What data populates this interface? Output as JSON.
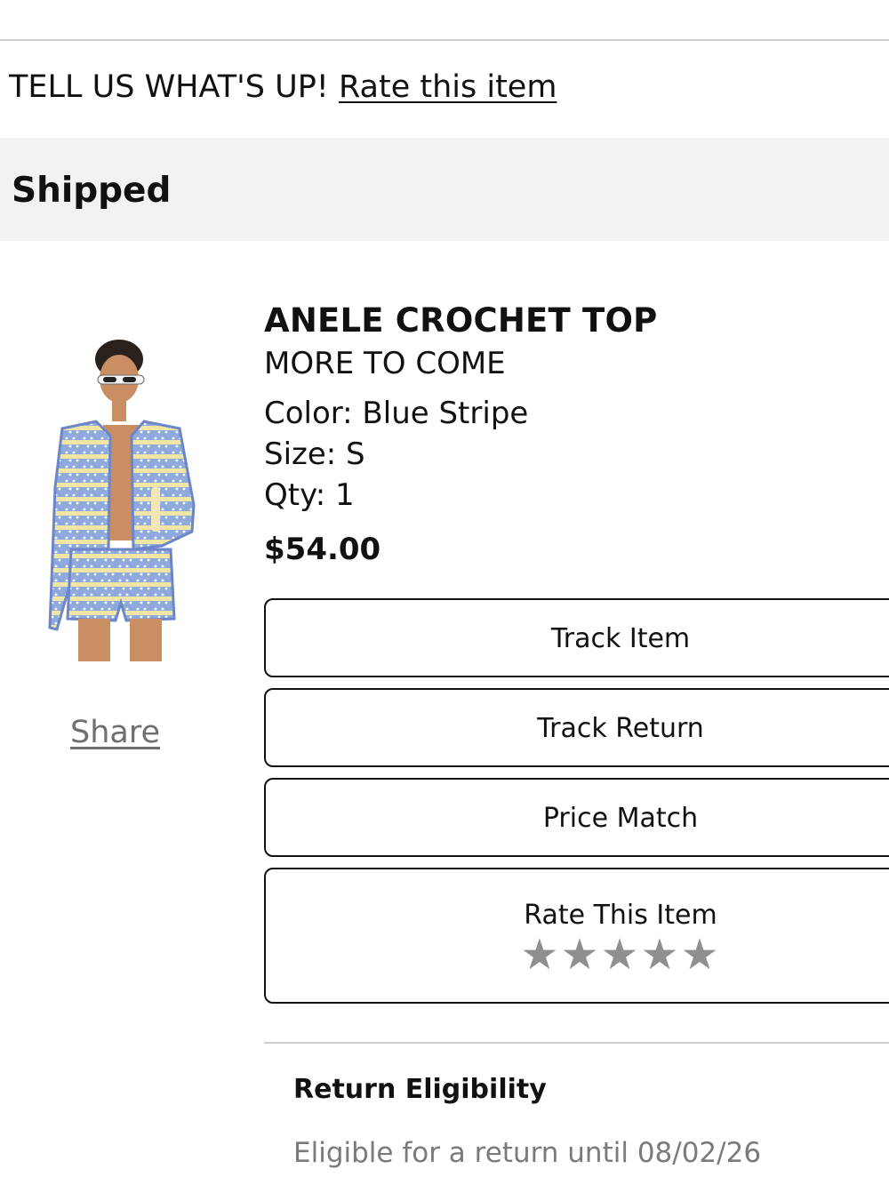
{
  "rating_prompt": {
    "text": "TELL US WHAT'S UP!",
    "link": "Rate this item"
  },
  "order_status": "Shipped",
  "product": {
    "name": "ANELE CROCHET TOP",
    "brand": "MORE TO COME",
    "color": "Color: Blue Stripe",
    "size": "Size: S",
    "qty": "Qty: 1",
    "price": "$54.00",
    "image_description": "model wearing blue and yellow striped crochet cardigan and shorts",
    "colors": {
      "primary_stripe": "#8ea9dc",
      "accent_stripe": "#efe6a6",
      "trim": "#6d86c9"
    }
  },
  "share_label": "Share",
  "actions": {
    "track_item": "Track Item",
    "track_return": "Track Return",
    "price_match": "Price Match",
    "rate_item": "Rate This Item",
    "star_count": 5,
    "star_icon": "star-icon"
  },
  "returns": {
    "title": "Return Eligibility",
    "text": "Eligible for a return until 08/02/26"
  },
  "theme": {
    "status_band": "#f2f2f2",
    "divider": "#cfcfcf",
    "star_color": "#8f8f8f",
    "muted_text": "#7a7a7a"
  }
}
